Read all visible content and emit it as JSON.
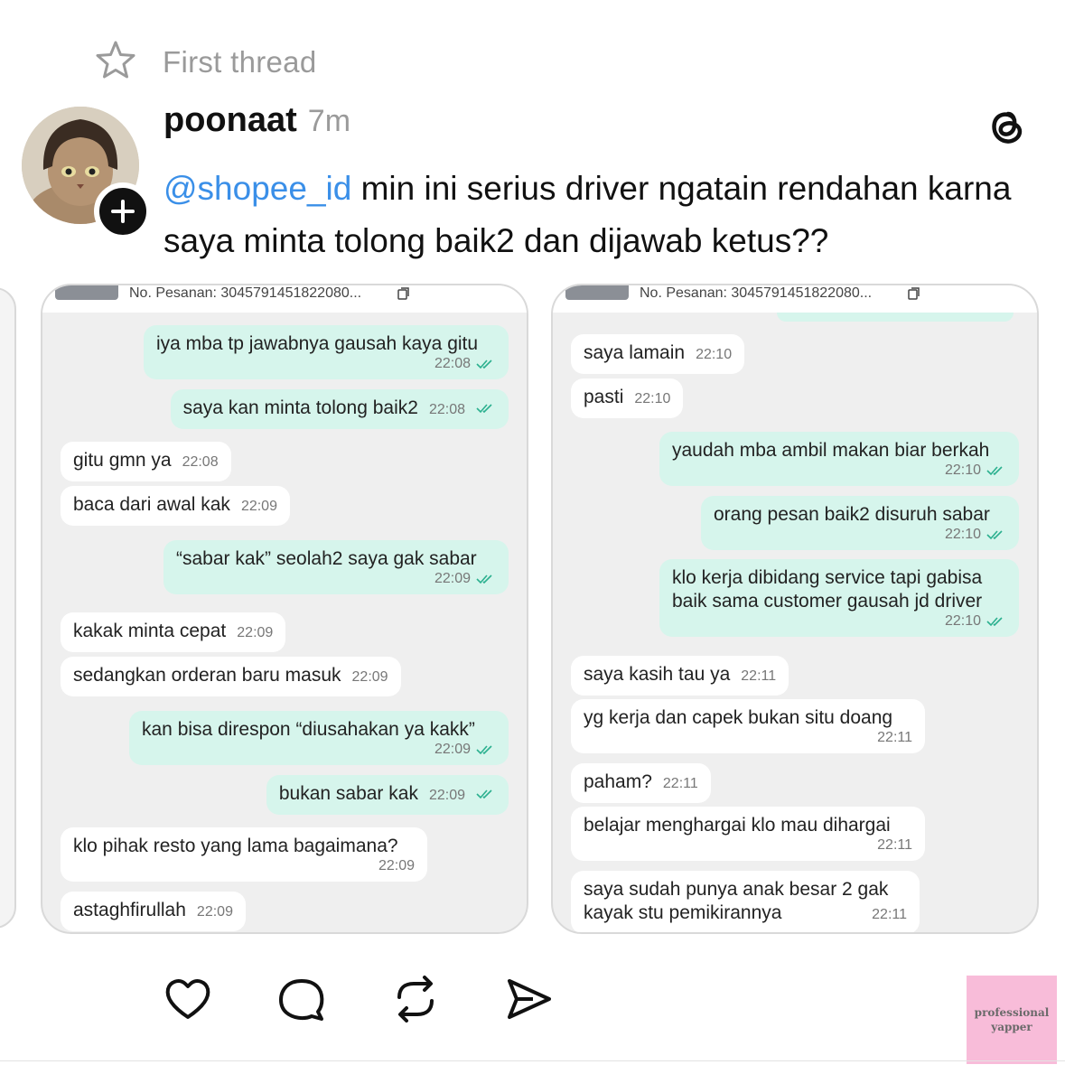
{
  "header": {
    "title": "First thread"
  },
  "post": {
    "username": "poonaat",
    "time_ago": "7m",
    "mention": "@shopee_id",
    "text": " min ini serius driver ngatain rendahan karna saya minta tolong baik2 dan dijawab ketus??"
  },
  "icons": [
    "star-icon",
    "plus-icon",
    "threads-logo-icon",
    "copy-icon",
    "double-check-icon",
    "heart-icon",
    "comment-icon",
    "repost-icon",
    "share-icon"
  ],
  "screenshots": [
    {
      "order_label": "No. Pesanan: 3045791451822080...",
      "messages": [
        {
          "side": "out",
          "text": "iya mba tp jawabnya gausah kaya gitu",
          "time": "22:08"
        },
        {
          "side": "out",
          "text": "saya kan minta tolong baik2",
          "time": "22:08"
        },
        {
          "side": "in",
          "text": "gitu gmn ya",
          "time": "22:08"
        },
        {
          "side": "in",
          "text": "baca dari awal kak",
          "time": "22:09"
        },
        {
          "side": "out",
          "text": "“sabar kak” seolah2 saya gak sabar",
          "time": "22:09"
        },
        {
          "side": "in",
          "text": "kakak minta cepat",
          "time": "22:09"
        },
        {
          "side": "in",
          "text": "sedangkan orderan baru masuk",
          "time": "22:09"
        },
        {
          "side": "out",
          "text": "kan bisa direspon “diusahakan ya kakk”",
          "time": "22:09"
        },
        {
          "side": "out",
          "text": "bukan sabar kak",
          "time": "22:09"
        },
        {
          "side": "in",
          "text": "klo pihak resto yang lama bagaimana?",
          "time": "22:09"
        },
        {
          "side": "in",
          "text": "astaghfirullah",
          "time": "22:09"
        }
      ]
    },
    {
      "order_label": "No. Pesanan: 3045791451822080...",
      "messages": [
        {
          "side": "in",
          "text": "saya lamain",
          "time": "22:10"
        },
        {
          "side": "in",
          "text": "pasti",
          "time": "22:10"
        },
        {
          "side": "out",
          "text": "yaudah mba ambil makan biar berkah",
          "time": "22:10"
        },
        {
          "side": "out",
          "text": "orang pesan baik2 disuruh sabar",
          "time": "22:10"
        },
        {
          "side": "out",
          "line1": "klo kerja dibidang service tapi gabisa",
          "line2": "baik sama customer gausah jd driver",
          "time": "22:10"
        },
        {
          "side": "in",
          "text": "saya kasih tau ya",
          "time": "22:11"
        },
        {
          "side": "in",
          "text": "yg kerja dan capek bukan situ doang",
          "time": "22:11"
        },
        {
          "side": "in",
          "text": "paham?",
          "time": "22:11"
        },
        {
          "side": "in",
          "text": "belajar menghargai klo mau dihargai",
          "time": "22:11"
        },
        {
          "side": "in",
          "line1": "saya sudah punya anak besar 2 gak",
          "line2": "kayak stu pemikirannya",
          "time": "22:11"
        }
      ]
    }
  ],
  "watermark": {
    "line1": "professional",
    "line2": "yapper"
  }
}
